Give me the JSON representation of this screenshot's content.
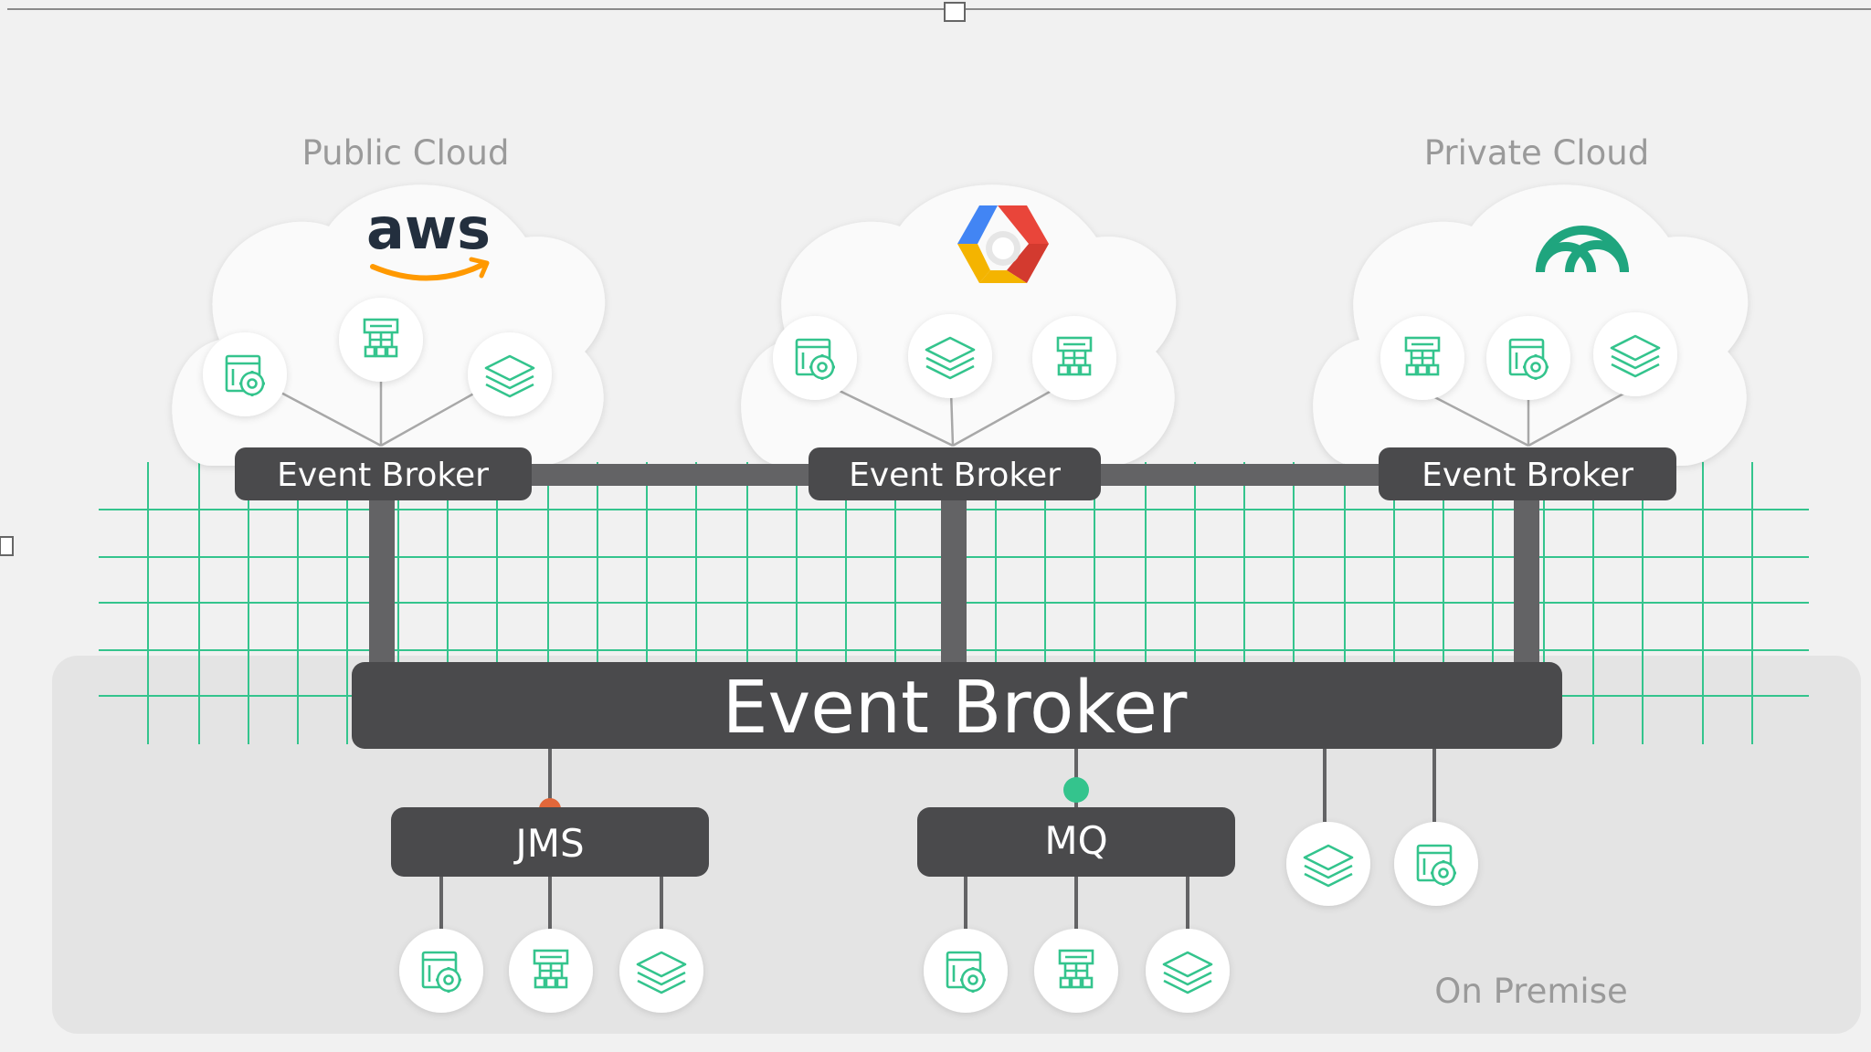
{
  "regions": {
    "public_cloud": "Public Cloud",
    "private_cloud": "Private Cloud",
    "on_premise": "On Premise"
  },
  "logos": {
    "aws": "aws",
    "gcp": "google-cloud-hexagon-logo",
    "private": "pivotal-cloud-foundry-logo"
  },
  "brokers": {
    "left": "Event Broker",
    "center": "Event Broker",
    "right": "Event Broker",
    "main": "Event Broker"
  },
  "protocols": {
    "jms": "JMS",
    "mq": "MQ"
  },
  "icons": {
    "app": "app-settings-icon",
    "flow": "flowchart-icon",
    "stack": "layers-icon"
  },
  "colors": {
    "accent": "#34c48d",
    "broker": "#4a4a4c",
    "connector": "#636365",
    "cloud": "#fafafa",
    "on_premise_panel": "#e4e4e4",
    "background": "#f1f1f1",
    "label_gray": "#9a9a9a"
  }
}
